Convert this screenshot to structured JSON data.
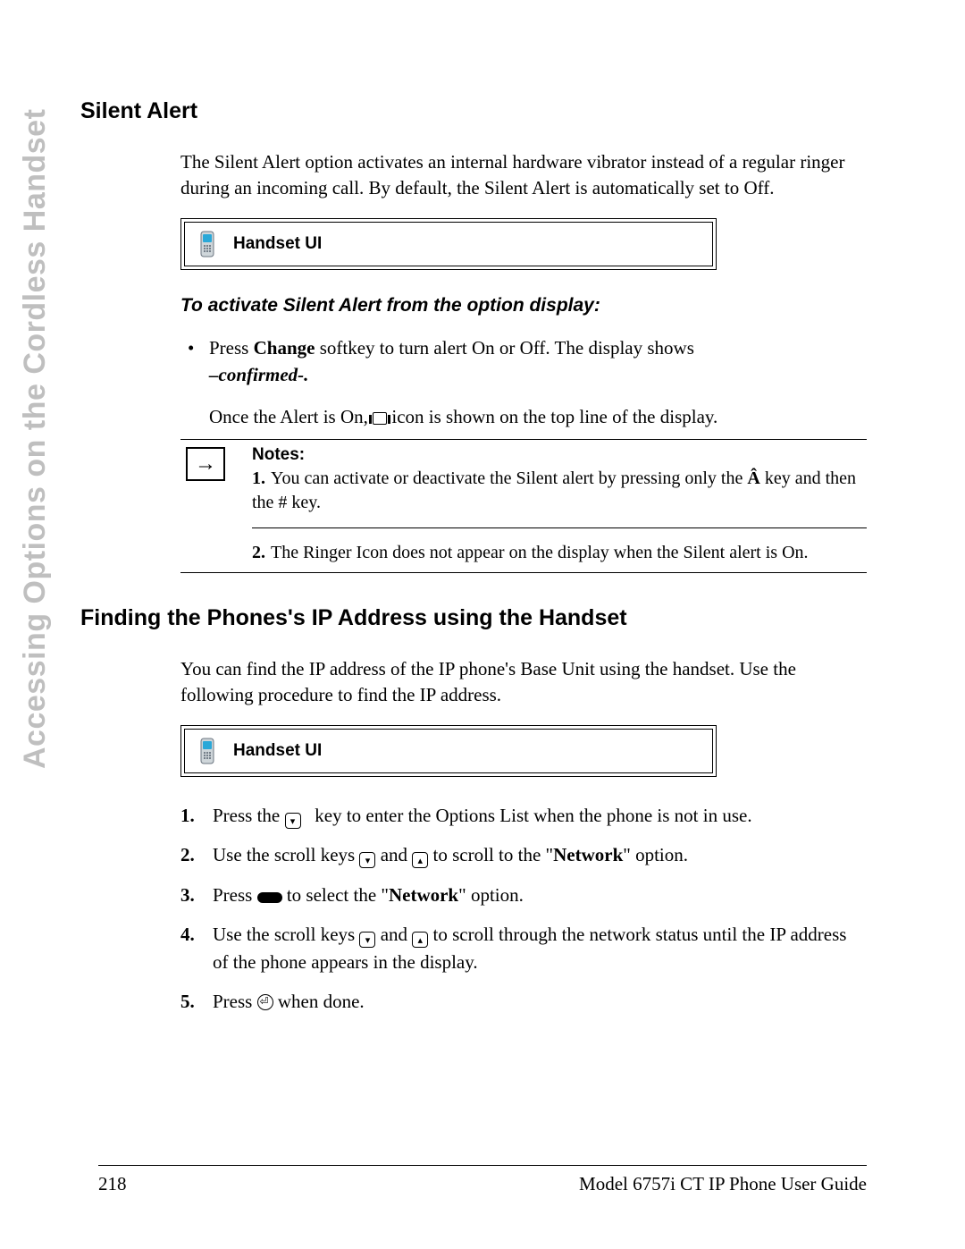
{
  "sidebar": {
    "label": "Accessing Options on the Cordless Handset"
  },
  "section1": {
    "heading": "Silent Alert",
    "intro": "The Silent Alert option activates an internal hardware vibrator instead of a regular ringer during an incoming call. By default, the Silent Alert is automatically set to Off.",
    "ui_label": "Handset UI",
    "subhead": "To activate Silent Alert from the option display:",
    "bullet_prefix": "Press ",
    "change_key": "Change",
    "bullet_middle": " softkey to turn alert On or Off. The display shows ",
    "confirmed": "–confirmed-.",
    "once_prefix": "Once the Alert is On, ",
    "once_suffix": " icon is shown on the top line of the display.",
    "notes_label": "Notes:",
    "note1_num": "1.",
    "note1_a": "You can activate or deactivate the Silent alert by pressing only the ",
    "note1_key": "Â",
    "note1_b": " key and then the # key.",
    "note2_num": "2.",
    "note2": "The Ringer Icon does not appear on the display when the Silent alert is On."
  },
  "section2": {
    "heading": "Finding the Phones's IP Address using the Handset",
    "intro": "You can find the IP address of the IP phone's Base Unit using the handset. Use the following procedure to find the IP address.",
    "ui_label": "Handset UI",
    "step1_a": "Press the ",
    "step1_b": " key to enter the Options List when the phone is not in use.",
    "step2_a": "Use the scroll keys ",
    "step2_and": " and ",
    "step2_b": " to scroll to the \"",
    "network": "Network",
    "step2_c": "\" option.",
    "step3_a": "Press ",
    "step3_b": " to select the \"",
    "step3_c": "\" option.",
    "step4_a": "Use the scroll keys ",
    "step4_b": " to scroll through the network status until the IP address of the phone appears in the display.",
    "step5_a": "Press ",
    "step5_b": " when done."
  },
  "footer": {
    "page": "218",
    "guide": "Model 6757i CT IP Phone User Guide"
  }
}
